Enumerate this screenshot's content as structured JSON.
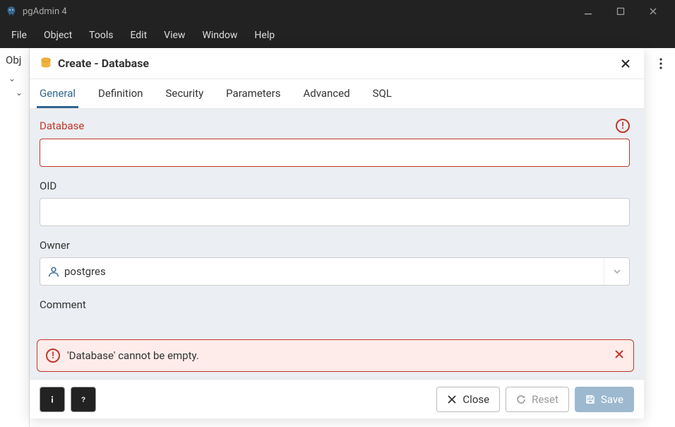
{
  "window": {
    "title": "pgAdmin 4"
  },
  "menubar": {
    "items": [
      "File",
      "Object",
      "Tools",
      "Edit",
      "View",
      "Window",
      "Help"
    ]
  },
  "sidebar": {
    "label": "Obj"
  },
  "dialog": {
    "title": "Create - Database",
    "tabs": [
      "General",
      "Definition",
      "Security",
      "Parameters",
      "Advanced",
      "SQL"
    ],
    "active_tab": 0,
    "fields": {
      "database": {
        "label": "Database",
        "value": "",
        "has_error": true
      },
      "oid": {
        "label": "OID",
        "value": ""
      },
      "owner": {
        "label": "Owner",
        "value": "postgres"
      },
      "comment": {
        "label": "Comment",
        "value": ""
      }
    },
    "error": {
      "message": "'Database' cannot be empty."
    },
    "footer": {
      "close": "Close",
      "reset": "Reset",
      "save": "Save"
    }
  }
}
